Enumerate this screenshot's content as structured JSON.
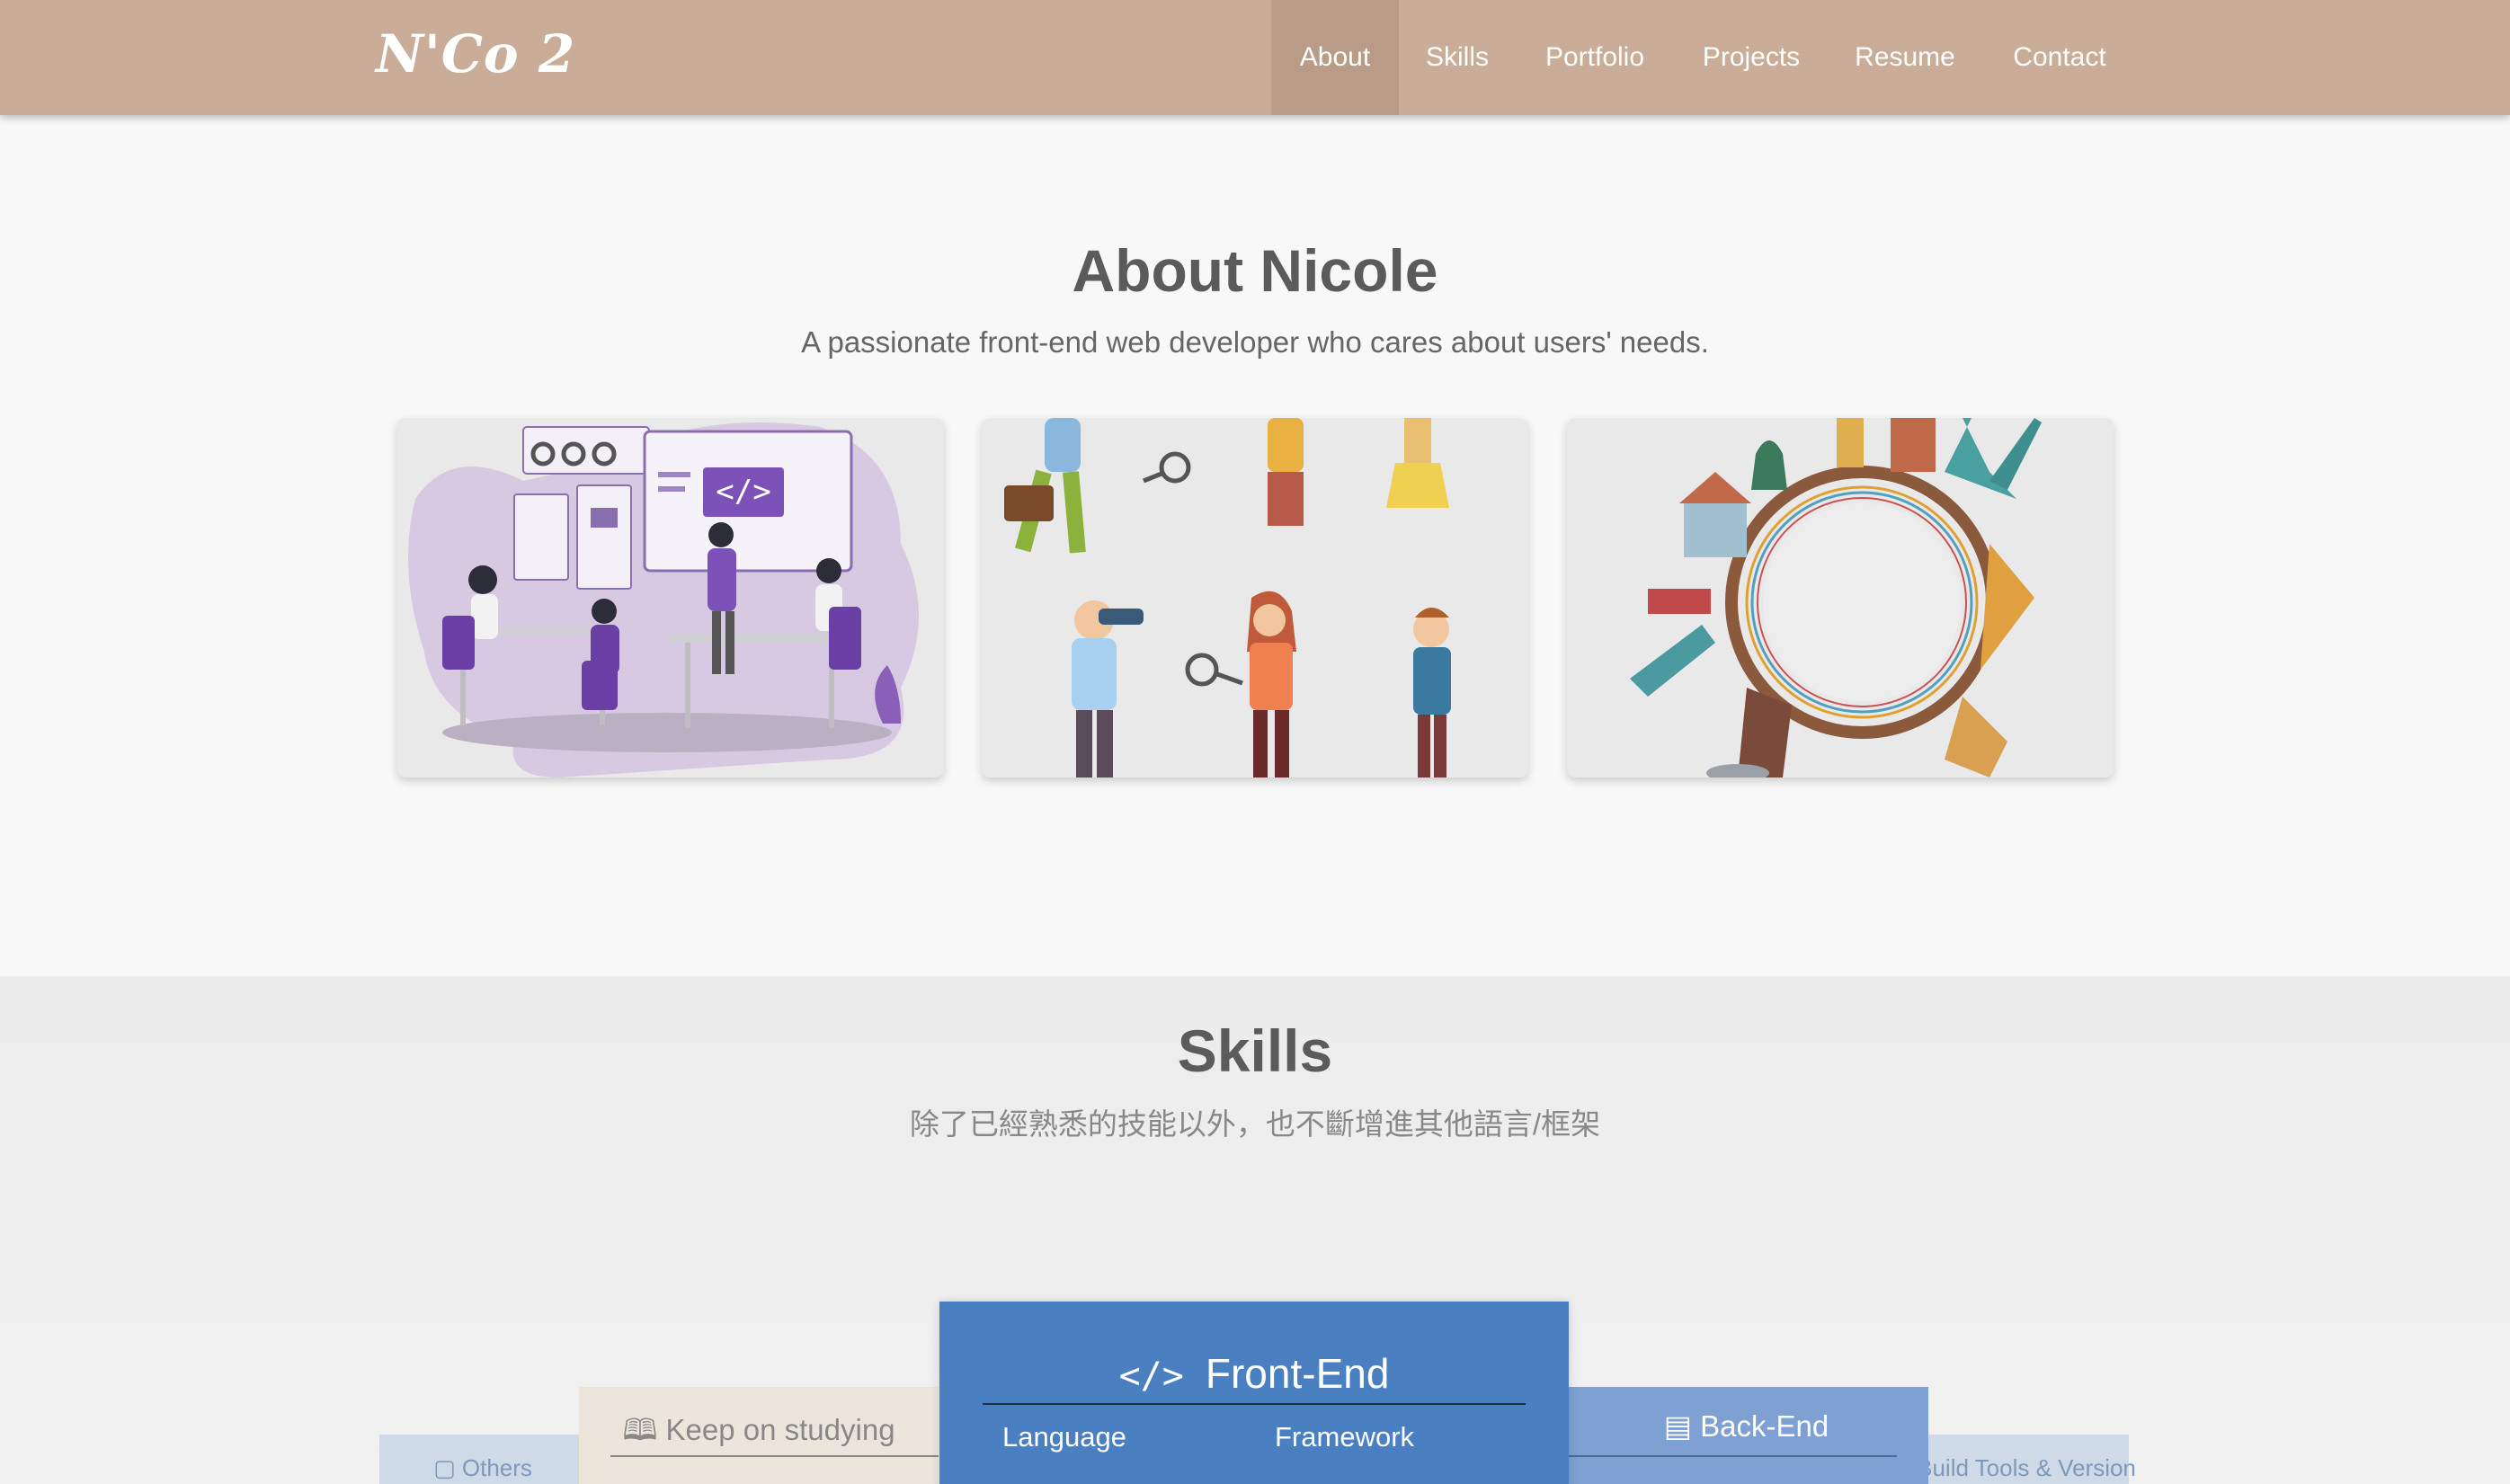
{
  "brand": "N'Co 2",
  "nav": [
    {
      "label": "About",
      "active": true
    },
    {
      "label": "Skills"
    },
    {
      "label": "Portfolio"
    },
    {
      "label": "Projects"
    },
    {
      "label": "Resume"
    },
    {
      "label": "Contact"
    }
  ],
  "about": {
    "title": "About Nicole",
    "subtitle": "A passionate front-end web developer who cares about users' needs.",
    "cards": [
      {
        "illustration": "team-coding-illustration"
      },
      {
        "illustration": "explorers-searching-illustration"
      },
      {
        "illustration": "world-landmarks-circle-illustration"
      }
    ]
  },
  "skills": {
    "title": "Skills",
    "subtitle": "除了已經熟悉的技能以外，也不斷增進其他語言/框架",
    "panels": {
      "others": {
        "label": "Others"
      },
      "keep_studying": {
        "label": "Keep on studying"
      },
      "front_end": {
        "label": "Front-End",
        "col1": "Language",
        "col2": "Framework"
      },
      "back_end": {
        "label": "Back-End"
      },
      "build_tools": {
        "label": "Build Tools & Version"
      }
    },
    "colors": {
      "front_end": "#4a7fc1",
      "back_end": "#7ea0d3",
      "keep": "#ebe5dc",
      "others": "#c9d6e6"
    }
  }
}
